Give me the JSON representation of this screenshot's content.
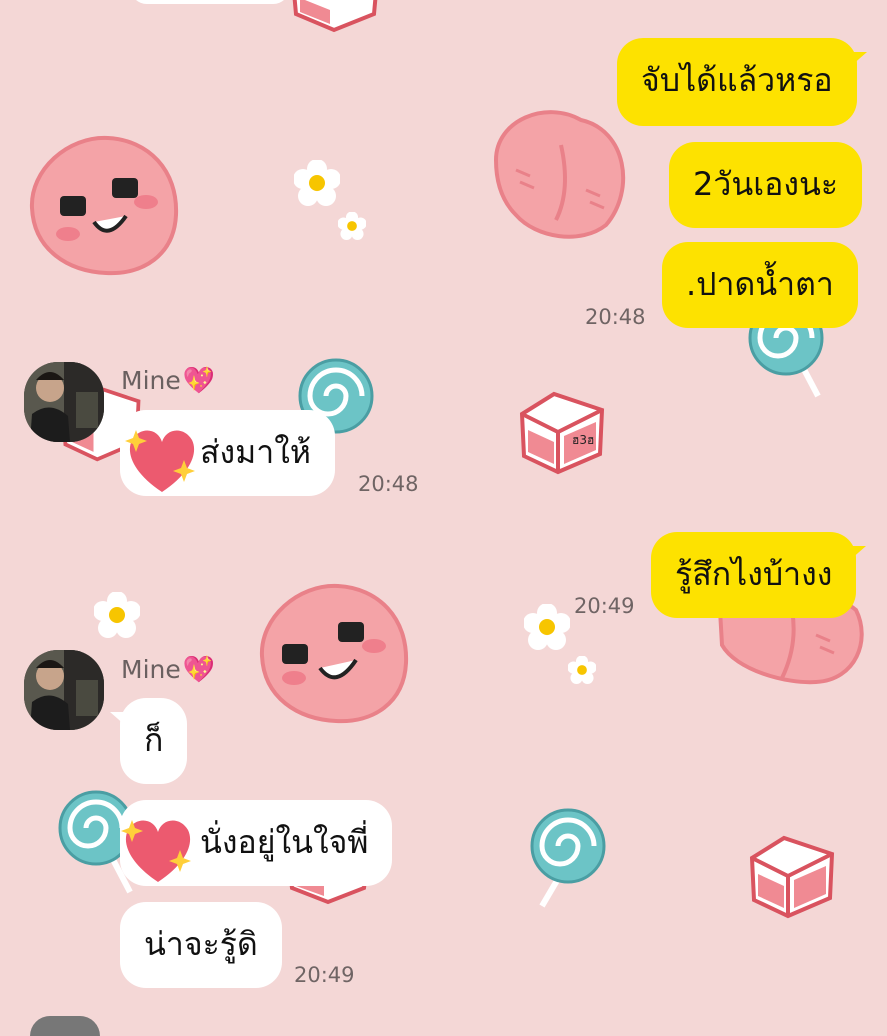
{
  "colors": {
    "background": "#f4d7d6",
    "outgoing_bubble": "#fde200",
    "incoming_bubble": "#ffffff",
    "time_text": "#6f6464"
  },
  "messages": [
    {
      "side": "outgoing",
      "text": "จับได้แล้วหรอ"
    },
    {
      "side": "outgoing",
      "text": "2วันเองนะ"
    },
    {
      "side": "outgoing",
      "text": ".ปาดน้ำตา"
    },
    {
      "side": "incoming",
      "text": "ส่งมาให้",
      "emoji": "sparkle-heart-icon"
    },
    {
      "side": "outgoing",
      "text": "รู้สึกไงบ้างง"
    },
    {
      "side": "incoming",
      "text": "ก็"
    },
    {
      "side": "incoming",
      "text": "นั่งอยู่ในใจพี่",
      "emoji": "sparkle-heart-icon"
    },
    {
      "side": "incoming",
      "text": "น่าจะรู้ดิ"
    }
  ],
  "times": {
    "t1": "20:48",
    "t2": "20:48",
    "t3": "20:49",
    "t4": "20:49"
  },
  "sender": {
    "name": "Mine",
    "name_suffix": "💖"
  }
}
